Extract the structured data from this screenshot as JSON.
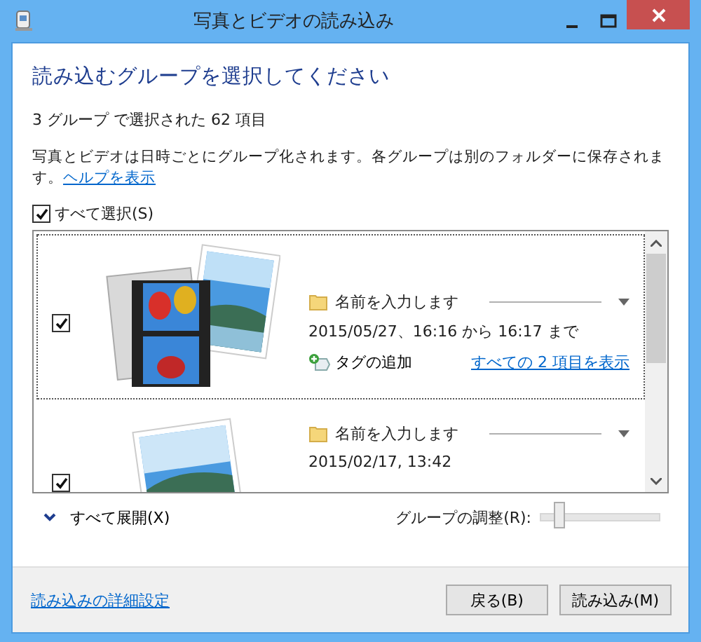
{
  "window": {
    "title": "写真とビデオの読み込み"
  },
  "heading": "読み込むグループを選択してください",
  "summary": "3 グループ で選択された 62 項目",
  "description": {
    "text": "写真とビデオは日時ごとにグループ化されます。各グループは別のフォルダーに保存されます。",
    "link": "ヘルプを表示"
  },
  "select_all": {
    "label": "すべて選択(S)",
    "checked": true
  },
  "groups": [
    {
      "checked": true,
      "focused": true,
      "kind": "video",
      "name_placeholder": "名前を入力します",
      "date": "2015/05/27、16:16 から 16:17 まで",
      "add_tag": "タグの追加",
      "view_all": "すべての 2 項目を表示"
    },
    {
      "checked": true,
      "focused": false,
      "name_placeholder": "名前を入力します",
      "date": "2015/02/17, 13:42"
    }
  ],
  "expand_all": "すべて展開(X)",
  "group_adjust": {
    "label": "グループの調整(R):",
    "level": 0.15
  },
  "footer": {
    "link": "読み込みの詳細設定",
    "buttons": [
      "戻る(B)",
      "読み込み(M)"
    ]
  }
}
